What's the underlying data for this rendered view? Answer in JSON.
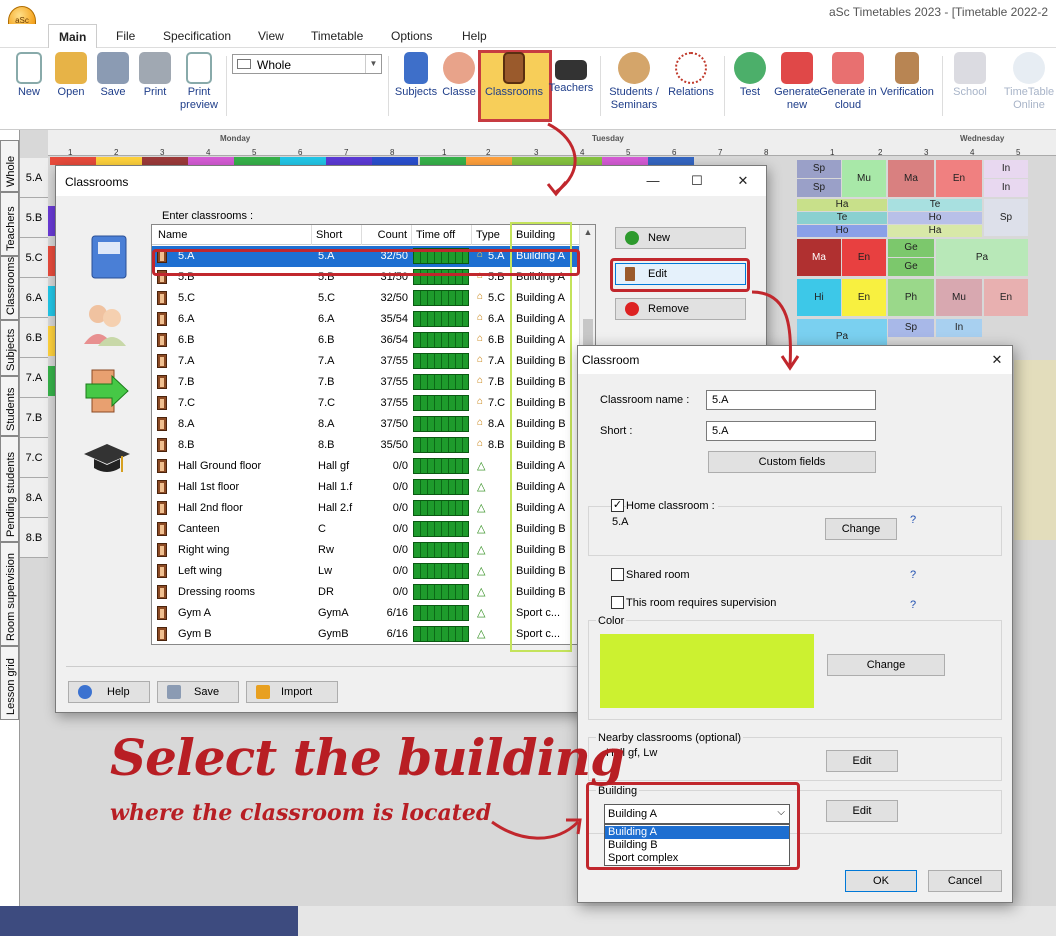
{
  "app": {
    "logo_text": "aSc",
    "title": "aSc Timetables 2023 - [Timetable 2022-2",
    "menu_tabs": [
      "Main",
      "File",
      "Specification",
      "View",
      "Timetable",
      "Options",
      "Help"
    ]
  },
  "ribbon": {
    "new": "New",
    "open": "Open",
    "save": "Save",
    "print": "Print",
    "print_preview": "Print preview",
    "view_select": "Whole",
    "subjects": "Subjects",
    "classes": "Classe",
    "classrooms": "Classrooms",
    "teachers": "Teachers",
    "students_seminars": "Students / Seminars",
    "relations": "Relations",
    "test": "Test",
    "generate_new": "Generate new",
    "generate_cloud": "Generate in cloud",
    "verification": "Verification",
    "school": "School",
    "timetable_online": "TimeTable Online"
  },
  "side_tabs": [
    "Whole",
    "Teachers",
    "Classrooms",
    "Subjects",
    "Students",
    "Pending students",
    "Room supervision",
    "Lesson grid"
  ],
  "timetable_bg": {
    "days": [
      "Monday",
      "Tuesday",
      "Wednesday"
    ],
    "periods": [
      "1",
      "2",
      "3",
      "4",
      "5",
      "6",
      "7",
      "8"
    ],
    "classes": [
      "5.A",
      "5.B",
      "5.C",
      "6.A",
      "6.B",
      "7.A",
      "7.B",
      "7.C",
      "8.A",
      "8.B"
    ],
    "cells": [
      "Ma",
      "Ho",
      "Sp",
      "Mu",
      "Ma",
      "En",
      "In",
      "Sp",
      "In",
      "Ha",
      "Te",
      "Te",
      "Ho",
      "Ho",
      "Ha",
      "Sp",
      "Ma",
      "En",
      "Ge",
      "Ge",
      "Pa",
      "Hi",
      "En",
      "Ph",
      "Mu",
      "En",
      "Sp",
      "In",
      "Pa"
    ]
  },
  "dlg_classrooms": {
    "title": "Classrooms",
    "enter_label": "Enter classrooms :",
    "columns": [
      "Name",
      "Short",
      "Count",
      "Time off",
      "Type",
      "Building"
    ],
    "rows": [
      {
        "name": "5.A",
        "short": "5.A",
        "count": "32/50",
        "type": "5.A",
        "building": "Building A"
      },
      {
        "name": "5.B",
        "short": "5.B",
        "count": "31/50",
        "type": "5.B",
        "building": "Building A"
      },
      {
        "name": "5.C",
        "short": "5.C",
        "count": "32/50",
        "type": "5.C",
        "building": "Building A"
      },
      {
        "name": "6.A",
        "short": "6.A",
        "count": "35/54",
        "type": "6.A",
        "building": "Building A"
      },
      {
        "name": "6.B",
        "short": "6.B",
        "count": "36/54",
        "type": "6.B",
        "building": "Building A"
      },
      {
        "name": "7.A",
        "short": "7.A",
        "count": "37/55",
        "type": "7.A",
        "building": "Building B"
      },
      {
        "name": "7.B",
        "short": "7.B",
        "count": "37/55",
        "type": "7.B",
        "building": "Building B"
      },
      {
        "name": "7.C",
        "short": "7.C",
        "count": "37/55",
        "type": "7.C",
        "building": "Building B"
      },
      {
        "name": "8.A",
        "short": "8.A",
        "count": "37/50",
        "type": "8.A",
        "building": "Building B"
      },
      {
        "name": "8.B",
        "short": "8.B",
        "count": "35/50",
        "type": "8.B",
        "building": "Building B"
      },
      {
        "name": "Hall Ground floor",
        "short": "Hall gf",
        "count": "0/0",
        "type": "",
        "building": "Building A"
      },
      {
        "name": "Hall 1st floor",
        "short": "Hall 1.f",
        "count": "0/0",
        "type": "",
        "building": "Building A"
      },
      {
        "name": "Hall 2nd floor",
        "short": "Hall 2.f",
        "count": "0/0",
        "type": "",
        "building": "Building A"
      },
      {
        "name": "Canteen",
        "short": "C",
        "count": "0/0",
        "type": "",
        "building": "Building B"
      },
      {
        "name": "Right wing",
        "short": "Rw",
        "count": "0/0",
        "type": "",
        "building": "Building B"
      },
      {
        "name": "Left wing",
        "short": "Lw",
        "count": "0/0",
        "type": "",
        "building": "Building B"
      },
      {
        "name": "Dressing rooms",
        "short": "DR",
        "count": "0/0",
        "type": "",
        "building": "Building B"
      },
      {
        "name": "Gym A",
        "short": "GymA",
        "count": "6/16",
        "type": "",
        "building": "Sport c..."
      },
      {
        "name": "Gym B",
        "short": "GymB",
        "count": "6/16",
        "type": "",
        "building": "Sport c..."
      }
    ],
    "btn_new": "New",
    "btn_edit": "Edit",
    "btn_remove": "Remove",
    "btn_help": "Help",
    "btn_save": "Save",
    "btn_import": "Import"
  },
  "dlg_classroom": {
    "title": "Classroom",
    "name_label": "Classroom name :",
    "name_value": "5.A",
    "short_label": "Short :",
    "short_value": "5.A",
    "custom_fields": "Custom fields",
    "home_label": "Home classroom :",
    "home_value": "5.A",
    "home_checked": "✓",
    "change": "Change",
    "q": "?",
    "shared_label": "Shared room",
    "supervision_label": "This room requires supervision",
    "color_label": "Color",
    "color_value": "#ccf130",
    "nearby_label": "Nearby classrooms (optional)",
    "nearby_value": "Hall gf, Lw",
    "edit": "Edit",
    "building_label": "Building",
    "building_value": "Building A",
    "building_options": [
      "Building A",
      "Building B",
      "Sport complex"
    ],
    "ok": "OK",
    "cancel": "Cancel"
  },
  "annotation": {
    "headline": "Select the building",
    "subline": "where the classroom is located"
  }
}
